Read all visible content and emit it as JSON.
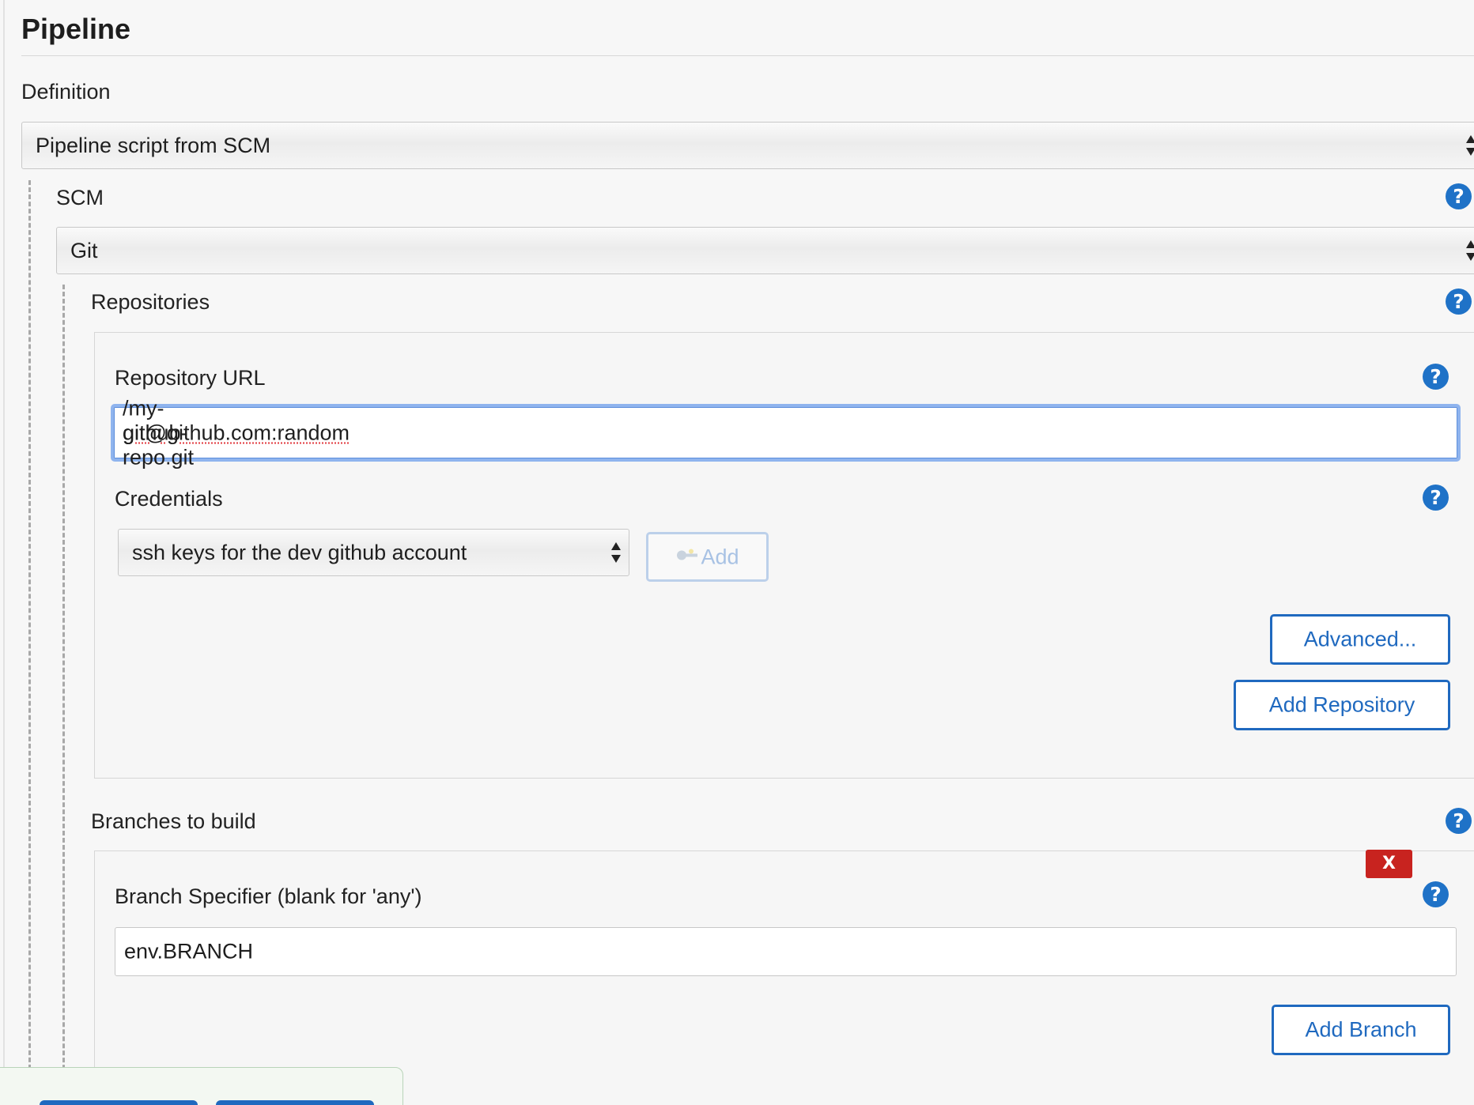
{
  "page": {
    "title": "Pipeline"
  },
  "definition": {
    "label": "Definition",
    "selected": "Pipeline script from SCM"
  },
  "scm": {
    "label": "SCM",
    "selected": "Git"
  },
  "repositories": {
    "label": "Repositories",
    "url_label": "Repository URL",
    "url_value_underlined": "git@github.com:random",
    "url_value_rest": "/my-github-repo.git",
    "credentials_label": "Credentials",
    "credentials_selected": "ssh keys for the dev github account",
    "add_credentials_label": "Add",
    "advanced_label": "Advanced...",
    "add_repository_label": "Add Repository"
  },
  "branches": {
    "label": "Branches to build",
    "delete_label": "X",
    "specifier_label": "Branch Specifier (blank for 'any')",
    "specifier_value": "env.BRANCH",
    "add_branch_label": "Add Branch"
  },
  "help": {
    "glyph": "?"
  },
  "colors": {
    "accent": "#1f69bf",
    "help": "#1f72c7",
    "delete": "#c8231f",
    "focus_ring": "#8fb4ee"
  },
  "icons": {
    "help": "help-icon",
    "select_arrows": "select-arrows-icon",
    "key": "key-icon"
  }
}
